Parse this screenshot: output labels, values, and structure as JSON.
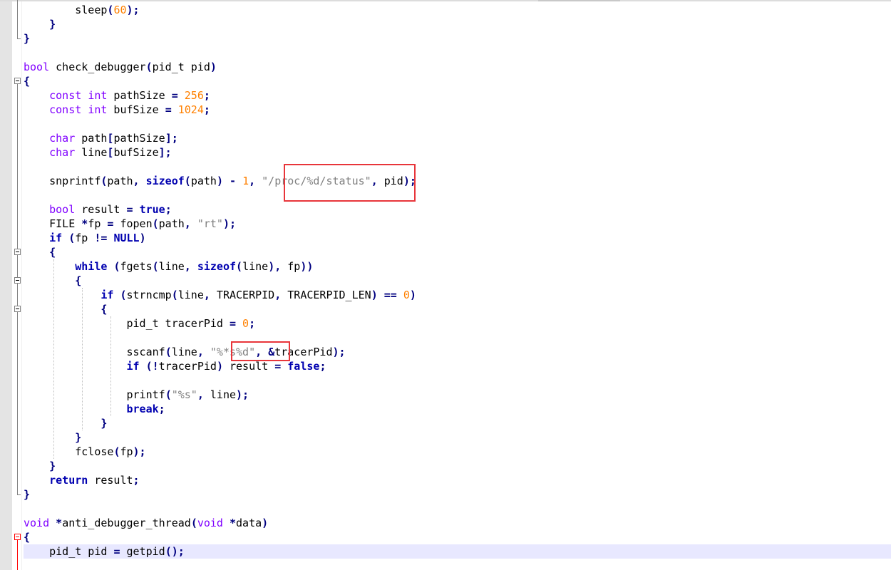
{
  "editor": {
    "lines": [
      {
        "n": 1,
        "segments": [
          {
            "t": "        sleep"
          },
          {
            "t": "(",
            "c": "op"
          },
          {
            "t": "60",
            "c": "num"
          },
          {
            "t": ");",
            "c": "op"
          }
        ]
      },
      {
        "n": 2,
        "segments": [
          {
            "t": "    "
          },
          {
            "t": "}",
            "c": "op"
          }
        ]
      },
      {
        "n": 3,
        "segments": [
          {
            "t": "}",
            "c": "op"
          }
        ]
      },
      {
        "n": 4,
        "segments": []
      },
      {
        "n": 5,
        "segments": [
          {
            "t": "bool",
            "c": "kw"
          },
          {
            "t": " check_debugger"
          },
          {
            "t": "(",
            "c": "op"
          },
          {
            "t": "pid_t pid"
          },
          {
            "t": ")",
            "c": "op"
          }
        ]
      },
      {
        "n": 6,
        "segments": [
          {
            "t": "{",
            "c": "op"
          }
        ]
      },
      {
        "n": 7,
        "segments": [
          {
            "t": "    "
          },
          {
            "t": "const",
            "c": "kw"
          },
          {
            "t": " "
          },
          {
            "t": "int",
            "c": "kw"
          },
          {
            "t": " pathSize "
          },
          {
            "t": "=",
            "c": "op"
          },
          {
            "t": " "
          },
          {
            "t": "256",
            "c": "num"
          },
          {
            "t": ";",
            "c": "op"
          }
        ]
      },
      {
        "n": 8,
        "segments": [
          {
            "t": "    "
          },
          {
            "t": "const",
            "c": "kw"
          },
          {
            "t": " "
          },
          {
            "t": "int",
            "c": "kw"
          },
          {
            "t": " bufSize "
          },
          {
            "t": "=",
            "c": "op"
          },
          {
            "t": " "
          },
          {
            "t": "1024",
            "c": "num"
          },
          {
            "t": ";",
            "c": "op"
          }
        ]
      },
      {
        "n": 9,
        "segments": []
      },
      {
        "n": 10,
        "segments": [
          {
            "t": "    "
          },
          {
            "t": "char",
            "c": "kw"
          },
          {
            "t": " path"
          },
          {
            "t": "[",
            "c": "op"
          },
          {
            "t": "pathSize"
          },
          {
            "t": "];",
            "c": "op"
          }
        ]
      },
      {
        "n": 11,
        "segments": [
          {
            "t": "    "
          },
          {
            "t": "char",
            "c": "kw"
          },
          {
            "t": " line"
          },
          {
            "t": "[",
            "c": "op"
          },
          {
            "t": "bufSize"
          },
          {
            "t": "];",
            "c": "op"
          }
        ]
      },
      {
        "n": 12,
        "segments": []
      },
      {
        "n": 13,
        "segments": [
          {
            "t": "    snprintf"
          },
          {
            "t": "(",
            "c": "op"
          },
          {
            "t": "path"
          },
          {
            "t": ",",
            "c": "op"
          },
          {
            "t": " "
          },
          {
            "t": "sizeof",
            "c": "kwb"
          },
          {
            "t": "(",
            "c": "op"
          },
          {
            "t": "path"
          },
          {
            "t": ")",
            "c": "op"
          },
          {
            "t": " "
          },
          {
            "t": "-",
            "c": "op"
          },
          {
            "t": " "
          },
          {
            "t": "1",
            "c": "num"
          },
          {
            "t": ",",
            "c": "op"
          },
          {
            "t": " "
          },
          {
            "t": "\"/proc/%d/status\"",
            "c": "str"
          },
          {
            "t": ",",
            "c": "op"
          },
          {
            "t": " pid"
          },
          {
            "t": ");",
            "c": "op"
          }
        ]
      },
      {
        "n": 14,
        "segments": []
      },
      {
        "n": 15,
        "segments": [
          {
            "t": "    "
          },
          {
            "t": "bool",
            "c": "kw"
          },
          {
            "t": " result "
          },
          {
            "t": "=",
            "c": "op"
          },
          {
            "t": " "
          },
          {
            "t": "true",
            "c": "kwb"
          },
          {
            "t": ";",
            "c": "op"
          }
        ]
      },
      {
        "n": 16,
        "segments": [
          {
            "t": "    FILE "
          },
          {
            "t": "*",
            "c": "op"
          },
          {
            "t": "fp "
          },
          {
            "t": "=",
            "c": "op"
          },
          {
            "t": " fopen"
          },
          {
            "t": "(",
            "c": "op"
          },
          {
            "t": "path"
          },
          {
            "t": ",",
            "c": "op"
          },
          {
            "t": " "
          },
          {
            "t": "\"rt\"",
            "c": "str"
          },
          {
            "t": ");",
            "c": "op"
          }
        ]
      },
      {
        "n": 17,
        "segments": [
          {
            "t": "    "
          },
          {
            "t": "if",
            "c": "kwb"
          },
          {
            "t": " "
          },
          {
            "t": "(",
            "c": "op"
          },
          {
            "t": "fp "
          },
          {
            "t": "!=",
            "c": "op"
          },
          {
            "t": " "
          },
          {
            "t": "NULL",
            "c": "kwb"
          },
          {
            "t": ")",
            "c": "op"
          }
        ]
      },
      {
        "n": 18,
        "segments": [
          {
            "t": "    "
          },
          {
            "t": "{",
            "c": "op"
          }
        ]
      },
      {
        "n": 19,
        "segments": [
          {
            "t": "        "
          },
          {
            "t": "while",
            "c": "kwb"
          },
          {
            "t": " "
          },
          {
            "t": "(",
            "c": "op"
          },
          {
            "t": "fgets"
          },
          {
            "t": "(",
            "c": "op"
          },
          {
            "t": "line"
          },
          {
            "t": ",",
            "c": "op"
          },
          {
            "t": " "
          },
          {
            "t": "sizeof",
            "c": "kwb"
          },
          {
            "t": "(",
            "c": "op"
          },
          {
            "t": "line"
          },
          {
            "t": "),",
            "c": "op"
          },
          {
            "t": " fp"
          },
          {
            "t": "))",
            "c": "op"
          }
        ]
      },
      {
        "n": 20,
        "segments": [
          {
            "t": "        "
          },
          {
            "t": "{",
            "c": "op"
          }
        ]
      },
      {
        "n": 21,
        "segments": [
          {
            "t": "            "
          },
          {
            "t": "if",
            "c": "kwb"
          },
          {
            "t": " "
          },
          {
            "t": "(",
            "c": "op"
          },
          {
            "t": "strncmp"
          },
          {
            "t": "(",
            "c": "op"
          },
          {
            "t": "line"
          },
          {
            "t": ",",
            "c": "op"
          },
          {
            "t": " TRACERPID"
          },
          {
            "t": ",",
            "c": "op"
          },
          {
            "t": " TRACERPID_LEN"
          },
          {
            "t": ")",
            "c": "op"
          },
          {
            "t": " "
          },
          {
            "t": "==",
            "c": "op"
          },
          {
            "t": " "
          },
          {
            "t": "0",
            "c": "num"
          },
          {
            "t": ")",
            "c": "op"
          }
        ]
      },
      {
        "n": 22,
        "segments": [
          {
            "t": "            "
          },
          {
            "t": "{",
            "c": "op"
          }
        ]
      },
      {
        "n": 23,
        "segments": [
          {
            "t": "                pid_t tracerPid "
          },
          {
            "t": "=",
            "c": "op"
          },
          {
            "t": " "
          },
          {
            "t": "0",
            "c": "num"
          },
          {
            "t": ";",
            "c": "op"
          }
        ]
      },
      {
        "n": 24,
        "segments": []
      },
      {
        "n": 25,
        "segments": [
          {
            "t": "                sscanf"
          },
          {
            "t": "(",
            "c": "op"
          },
          {
            "t": "line"
          },
          {
            "t": ",",
            "c": "op"
          },
          {
            "t": " "
          },
          {
            "t": "\"%*s%d\"",
            "c": "str"
          },
          {
            "t": ",",
            "c": "op"
          },
          {
            "t": " "
          },
          {
            "t": "&",
            "c": "op"
          },
          {
            "t": "tracerPid"
          },
          {
            "t": ");",
            "c": "op"
          }
        ]
      },
      {
        "n": 26,
        "segments": [
          {
            "t": "                "
          },
          {
            "t": "if",
            "c": "kwb"
          },
          {
            "t": " "
          },
          {
            "t": "(!",
            "c": "op"
          },
          {
            "t": "tracerPid"
          },
          {
            "t": ")",
            "c": "op"
          },
          {
            "t": " result "
          },
          {
            "t": "=",
            "c": "op"
          },
          {
            "t": " "
          },
          {
            "t": "false",
            "c": "kwb"
          },
          {
            "t": ";",
            "c": "op"
          }
        ]
      },
      {
        "n": 27,
        "segments": []
      },
      {
        "n": 28,
        "segments": [
          {
            "t": "                printf"
          },
          {
            "t": "(",
            "c": "op"
          },
          {
            "t": "\"%s\"",
            "c": "str"
          },
          {
            "t": ",",
            "c": "op"
          },
          {
            "t": " line"
          },
          {
            "t": ");",
            "c": "op"
          }
        ]
      },
      {
        "n": 29,
        "segments": [
          {
            "t": "                "
          },
          {
            "t": "break",
            "c": "kwb"
          },
          {
            "t": ";",
            "c": "op"
          }
        ]
      },
      {
        "n": 30,
        "segments": [
          {
            "t": "            "
          },
          {
            "t": "}",
            "c": "op"
          }
        ]
      },
      {
        "n": 31,
        "segments": [
          {
            "t": "        "
          },
          {
            "t": "}",
            "c": "op"
          }
        ]
      },
      {
        "n": 32,
        "segments": [
          {
            "t": "        fclose"
          },
          {
            "t": "(",
            "c": "op"
          },
          {
            "t": "fp"
          },
          {
            "t": ");",
            "c": "op"
          }
        ]
      },
      {
        "n": 33,
        "segments": [
          {
            "t": "    "
          },
          {
            "t": "}",
            "c": "op"
          }
        ]
      },
      {
        "n": 34,
        "segments": [
          {
            "t": "    "
          },
          {
            "t": "return",
            "c": "kwb"
          },
          {
            "t": " result"
          },
          {
            "t": ";",
            "c": "op"
          }
        ]
      },
      {
        "n": 35,
        "segments": [
          {
            "t": "}",
            "c": "op"
          }
        ]
      },
      {
        "n": 36,
        "segments": []
      },
      {
        "n": 37,
        "segments": [
          {
            "t": "void",
            "c": "kw"
          },
          {
            "t": " "
          },
          {
            "t": "*",
            "c": "op"
          },
          {
            "t": "anti_debugger_thread"
          },
          {
            "t": "(",
            "c": "op"
          },
          {
            "t": "void",
            "c": "kw"
          },
          {
            "t": " "
          },
          {
            "t": "*",
            "c": "op"
          },
          {
            "t": "data"
          },
          {
            "t": ")",
            "c": "op"
          }
        ]
      },
      {
        "n": 38,
        "segments": [
          {
            "t": "{",
            "c": "op"
          }
        ]
      },
      {
        "n": 39,
        "segments": [
          {
            "t": "    pid_t pid "
          },
          {
            "t": "=",
            "c": "op"
          },
          {
            "t": " getpid"
          },
          {
            "t": "();",
            "c": "op"
          }
        ]
      }
    ]
  },
  "colors": {
    "keyword_type": "#8000ff",
    "keyword_instruction": "#0000b0",
    "number": "#ff8000",
    "string": "#808080",
    "operator": "#000080",
    "current_line": "#e8e8ff",
    "annotation_box": "#e8353a"
  }
}
